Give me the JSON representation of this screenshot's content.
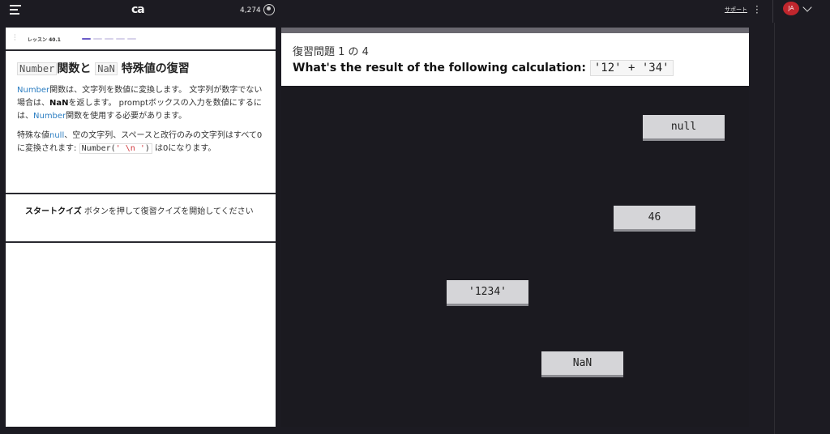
{
  "topbar": {
    "logo": "ca",
    "points": "4,274",
    "support": "サポート",
    "avatar_initials": "JA"
  },
  "lesson": {
    "label": "レッスン 40.1",
    "title_code1": "Number",
    "title_mid": "関数と",
    "title_code2": "NaN",
    "title_end": "特殊値の復習",
    "p1": {
      "kw1": "Number",
      "t1": "関数は、文字列を数値に変換します。 文字列が数字でない場合は、",
      "b1": "NaN",
      "t2": "を返します。 promptボックスの入力を数値にするには、",
      "kw2": "Number",
      "t3": "関数を使用する必要があります。"
    },
    "p2": {
      "t1": "特殊な値",
      "kw1": "null",
      "t2": "、空の文字列、スペースと改行のみの文字列はすべて0に変換されます: ",
      "code_fn": "Number(",
      "code_str": "' \\n '",
      "code_close": ")",
      "t3": " は0になります。"
    },
    "start_bold": "スタートクイズ",
    "start_text": " ボタンを押して復習クイズを開始してください"
  },
  "quiz": {
    "counter": "復習問題 1 の 4",
    "question": "What's the result of the following calculation: ",
    "question_code": "'12' + '34'",
    "answers": [
      "null",
      "46",
      "'1234'",
      "NaN"
    ]
  }
}
